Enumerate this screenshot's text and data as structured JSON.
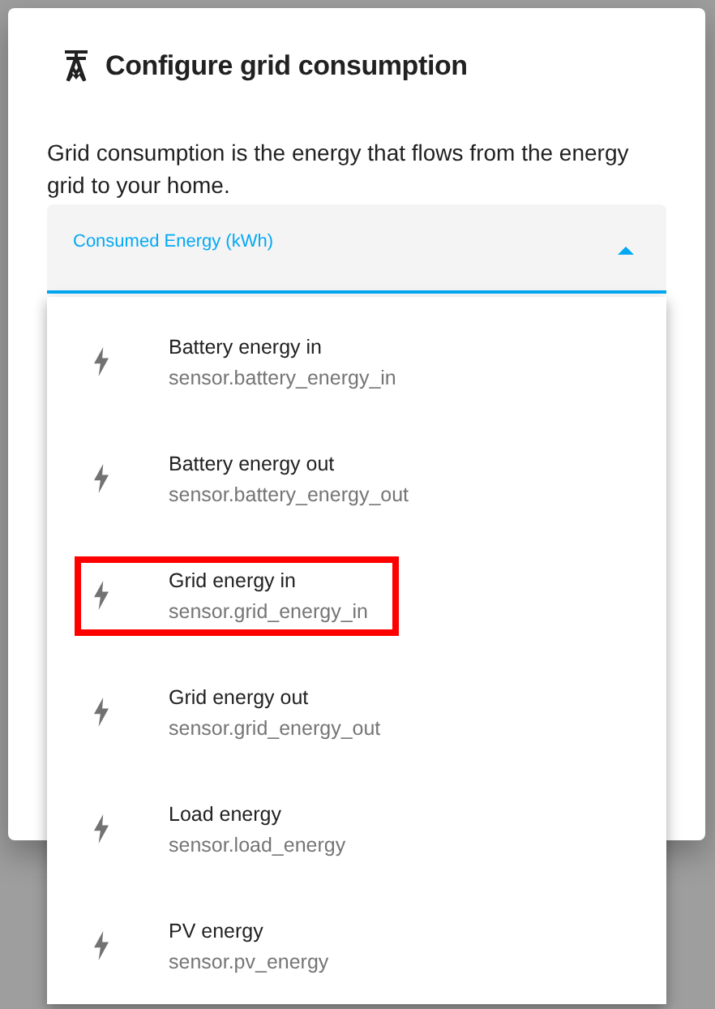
{
  "dialog": {
    "title": "Configure grid consumption",
    "description": "Grid consumption is the energy that flows from the energy grid to your home."
  },
  "field": {
    "label": "Consumed Energy (kWh)",
    "expanded": true
  },
  "options": [
    {
      "name": "Battery energy in",
      "entity": "sensor.battery_energy_in",
      "highlighted": false
    },
    {
      "name": "Battery energy out",
      "entity": "sensor.battery_energy_out",
      "highlighted": false
    },
    {
      "name": "Grid energy in",
      "entity": "sensor.grid_energy_in",
      "highlighted": true
    },
    {
      "name": "Grid energy out",
      "entity": "sensor.grid_energy_out",
      "highlighted": false
    },
    {
      "name": "Load energy",
      "entity": "sensor.load_energy",
      "highlighted": false
    },
    {
      "name": "PV energy",
      "entity": "sensor.pv_energy",
      "highlighted": false
    }
  ]
}
